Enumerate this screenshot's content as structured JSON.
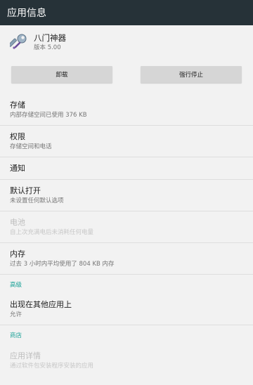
{
  "appbar": {
    "title": "应用信息"
  },
  "app": {
    "name": "八门神器",
    "version": "版本 5.00",
    "icon": "wrench-key-icon"
  },
  "buttons": {
    "uninstall": "卸载",
    "force_stop": "强行停止"
  },
  "items": {
    "storage": {
      "title": "存储",
      "sub": "内部存储空间已使用 376 KB"
    },
    "permissions": {
      "title": "权限",
      "sub": "存储空间和电话"
    },
    "notifications": {
      "title": "通知"
    },
    "open_by_default": {
      "title": "默认打开",
      "sub": "未设置任何默认选项"
    },
    "battery": {
      "title": "电池",
      "sub": "自上次充满电后未消耗任何电量"
    },
    "memory": {
      "title": "内存",
      "sub": "过去 3 小时内平均使用了 804 KB 内存"
    },
    "overlay": {
      "title": "出现在其他应用上",
      "sub": "允许"
    },
    "app_details": {
      "title": "应用详情",
      "sub": "通过软件包安装程序安装的应用"
    }
  },
  "sections": {
    "advanced": "高级",
    "store": "商店"
  },
  "colors": {
    "appbar": "#263238",
    "accent": "#1aa197",
    "background": "#f2f2f2"
  }
}
